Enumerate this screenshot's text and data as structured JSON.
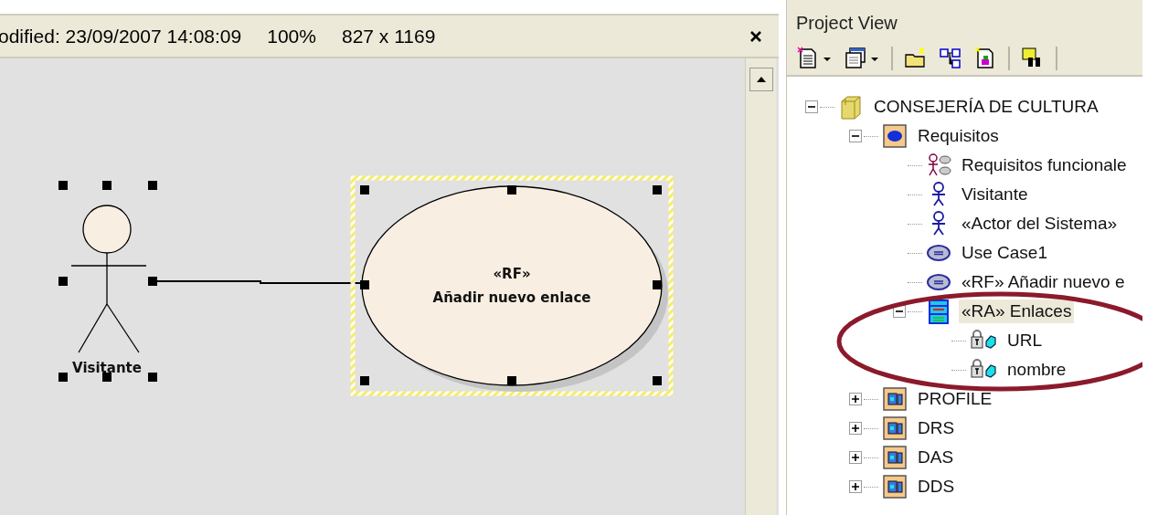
{
  "document_bar": {
    "fields": [
      "odified: 23/09/2007 14:08:09",
      "100%",
      "827 x 1169"
    ]
  },
  "diagram": {
    "elements": [
      {
        "kind": "actor",
        "name": "Visitante",
        "selected": true
      },
      {
        "kind": "use_case",
        "stereotype": "«RF»",
        "name": "Añadir nuevo enlace",
        "selected": true
      }
    ]
  },
  "project_view": {
    "title": "Project View",
    "tree": [
      {
        "label": "CONSEJERÍA DE CULTURA",
        "kind": "root",
        "expanded": true,
        "selected": false,
        "children": [
          {
            "label": "Requisitos",
            "kind": "package",
            "expanded": true,
            "selected": false,
            "children": [
              {
                "label": "Requisitos funcionale",
                "kind": "diagram",
                "selected": false
              },
              {
                "label": "Visitante",
                "kind": "actor",
                "selected": false
              },
              {
                "label": "«Actor del Sistema»",
                "kind": "actor",
                "selected": false
              },
              {
                "label": "Use Case1",
                "kind": "usecase",
                "selected": false
              },
              {
                "label": "«RF» Añadir nuevo e",
                "kind": "usecase",
                "selected": false
              },
              {
                "label": "«RA» Enlaces",
                "kind": "class",
                "expanded": true,
                "selected": true,
                "children": [
                  {
                    "label": "URL",
                    "kind": "attribute",
                    "selected": false
                  },
                  {
                    "label": "nombre",
                    "kind": "attribute",
                    "selected": false
                  }
                ]
              }
            ]
          },
          {
            "label": "PROFILE",
            "kind": "model",
            "expanded": false,
            "selected": false
          },
          {
            "label": "DRS",
            "kind": "model",
            "expanded": false,
            "selected": false
          },
          {
            "label": "DAS",
            "kind": "model",
            "expanded": false,
            "selected": false
          },
          {
            "label": "DDS",
            "kind": "model",
            "expanded": false,
            "selected": false
          }
        ]
      }
    ]
  }
}
